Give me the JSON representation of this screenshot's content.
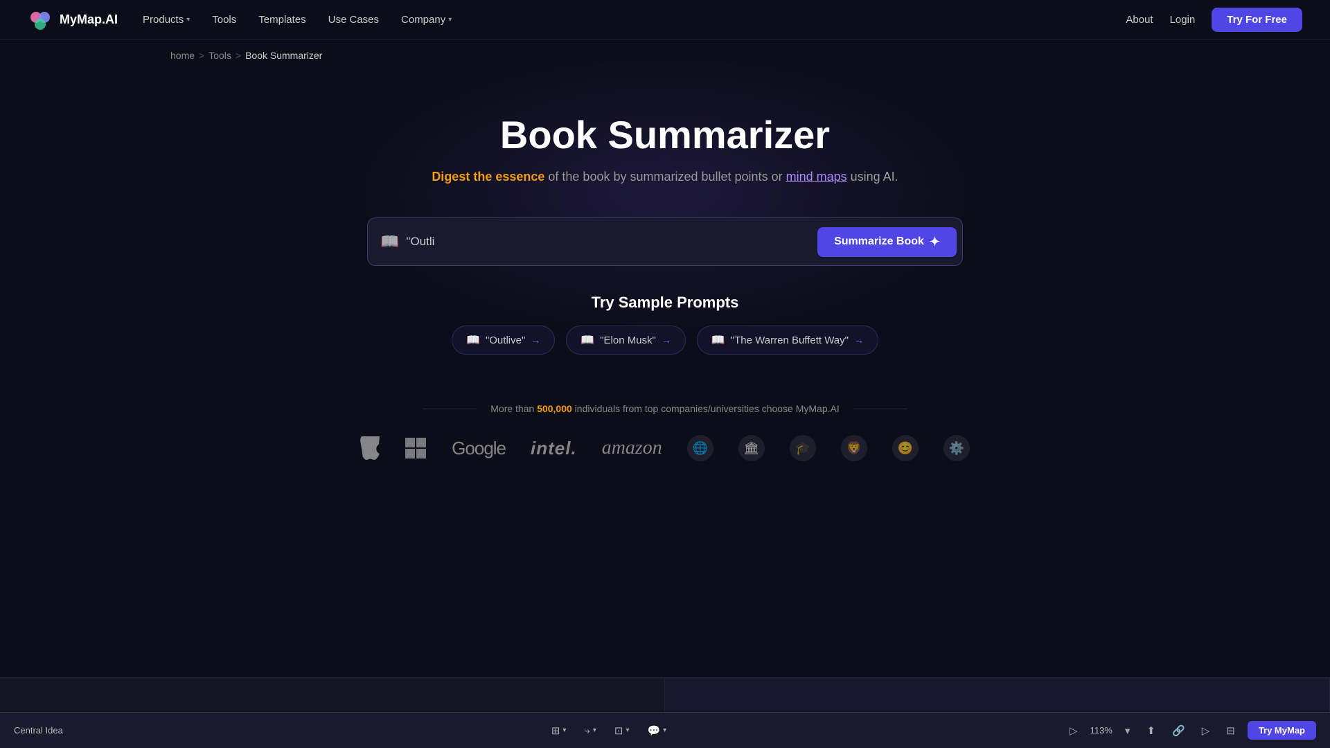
{
  "logo": {
    "text": "MyMap.AI"
  },
  "nav": {
    "links": [
      {
        "label": "Products",
        "hasChevron": true
      },
      {
        "label": "Tools",
        "hasChevron": false
      },
      {
        "label": "Templates",
        "hasChevron": false
      },
      {
        "label": "Use Cases",
        "hasChevron": false
      },
      {
        "label": "Company",
        "hasChevron": true
      }
    ],
    "right_links": [
      {
        "label": "About"
      },
      {
        "label": "Login"
      }
    ],
    "cta": "Try For Free"
  },
  "breadcrumb": {
    "home": "home",
    "sep1": ">",
    "tools": "Tools",
    "sep2": ">",
    "current": "Book Summarizer"
  },
  "hero": {
    "title": "Book Summarizer",
    "subtitle_pre": "Digest the essence",
    "subtitle_mid": " of the book by summarized bullet points or ",
    "subtitle_link": "mind maps",
    "subtitle_post": " using AI."
  },
  "search": {
    "placeholder": "📖 \"Outli",
    "input_value": "\"Outli",
    "button_label": "Summarize Book",
    "book_icon": "📖"
  },
  "sample_prompts": {
    "title": "Try Sample Prompts",
    "chips": [
      {
        "icon": "📖",
        "label": "\"Outlive\"",
        "arrow": "→"
      },
      {
        "icon": "📖",
        "label": "\"Elon Musk\"",
        "arrow": "→"
      },
      {
        "icon": "📖",
        "label": "\"The Warren Buffett Way\"",
        "arrow": "→"
      }
    ]
  },
  "social_proof": {
    "text_pre": "More than ",
    "number": "500,000",
    "text_post": " individuals from top companies/universities choose MyMap.AI"
  },
  "companies": [
    {
      "name": "Apple",
      "type": "apple"
    },
    {
      "name": "Microsoft",
      "type": "windows"
    },
    {
      "name": "Google",
      "type": "google"
    },
    {
      "name": "Intel",
      "type": "intel"
    },
    {
      "name": "Amazon",
      "type": "amazon"
    },
    {
      "name": "UN",
      "type": "icon",
      "symbol": "🌐"
    },
    {
      "name": "Org2",
      "type": "icon",
      "symbol": "🏛️"
    },
    {
      "name": "Org3",
      "type": "icon",
      "symbol": "🎓"
    },
    {
      "name": "Org4",
      "type": "icon",
      "symbol": "🦁"
    },
    {
      "name": "Org5",
      "type": "icon",
      "symbol": "😊"
    },
    {
      "name": "Org6",
      "type": "icon",
      "symbol": "⚙️"
    }
  ],
  "bottom_toolbar": {
    "label": "Central Idea",
    "zoom": "113%",
    "try_mymap": "Try MyMap"
  }
}
